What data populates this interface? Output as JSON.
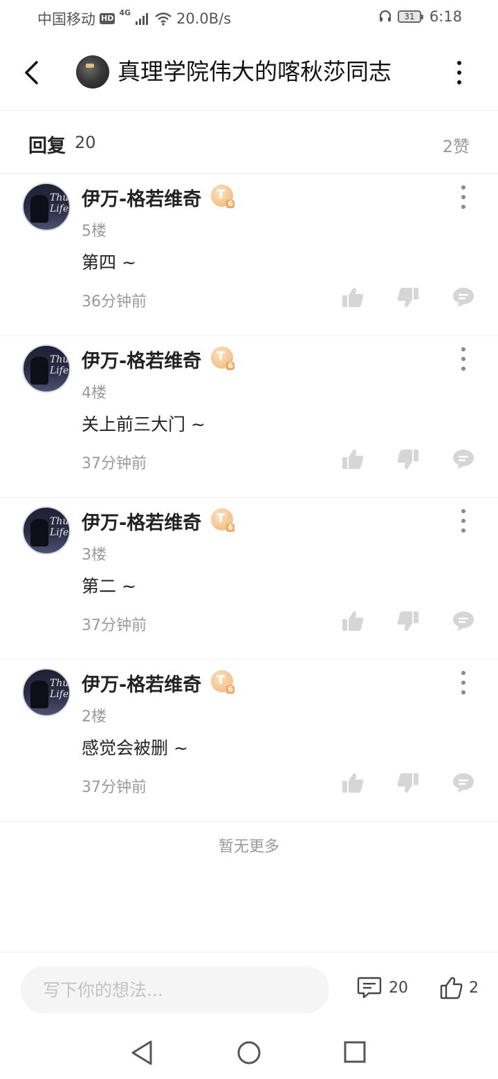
{
  "status_bar": {
    "carrier": "中国移动",
    "hd": "HD",
    "network": "4G",
    "speed": "20.0B/s",
    "battery": "31",
    "time": "6:18"
  },
  "header": {
    "title": "真理学院伟大的喀秋莎同志"
  },
  "reply_header": {
    "label": "回复",
    "count": "20",
    "likes": "2赞"
  },
  "comments": [
    {
      "name": "伊万-格若维奇",
      "badge": "T",
      "badge_level": "6",
      "floor": "5楼",
      "text": "第四 ~",
      "time": "36分钟前"
    },
    {
      "name": "伊万-格若维奇",
      "badge": "T",
      "badge_level": "6",
      "floor": "4楼",
      "text": "关上前三大门 ~",
      "time": "37分钟前"
    },
    {
      "name": "伊万-格若维奇",
      "badge": "T",
      "badge_level": "6",
      "floor": "3楼",
      "text": "第二 ~",
      "time": "37分钟前"
    },
    {
      "name": "伊万-格若维奇",
      "badge": "T",
      "badge_level": "6",
      "floor": "2楼",
      "text": "感觉会被删 ~",
      "time": "37分钟前"
    }
  ],
  "avatar_text": "Thug Life",
  "footer_note": "暂无更多",
  "input_bar": {
    "placeholder": "写下你的想法...",
    "comment_count": "20",
    "like_count": "2"
  },
  "colors": {
    "text_primary": "#222222",
    "text_secondary": "#999999",
    "icon_gray": "#d6d6d6",
    "badge_orange": "#f5c590"
  }
}
